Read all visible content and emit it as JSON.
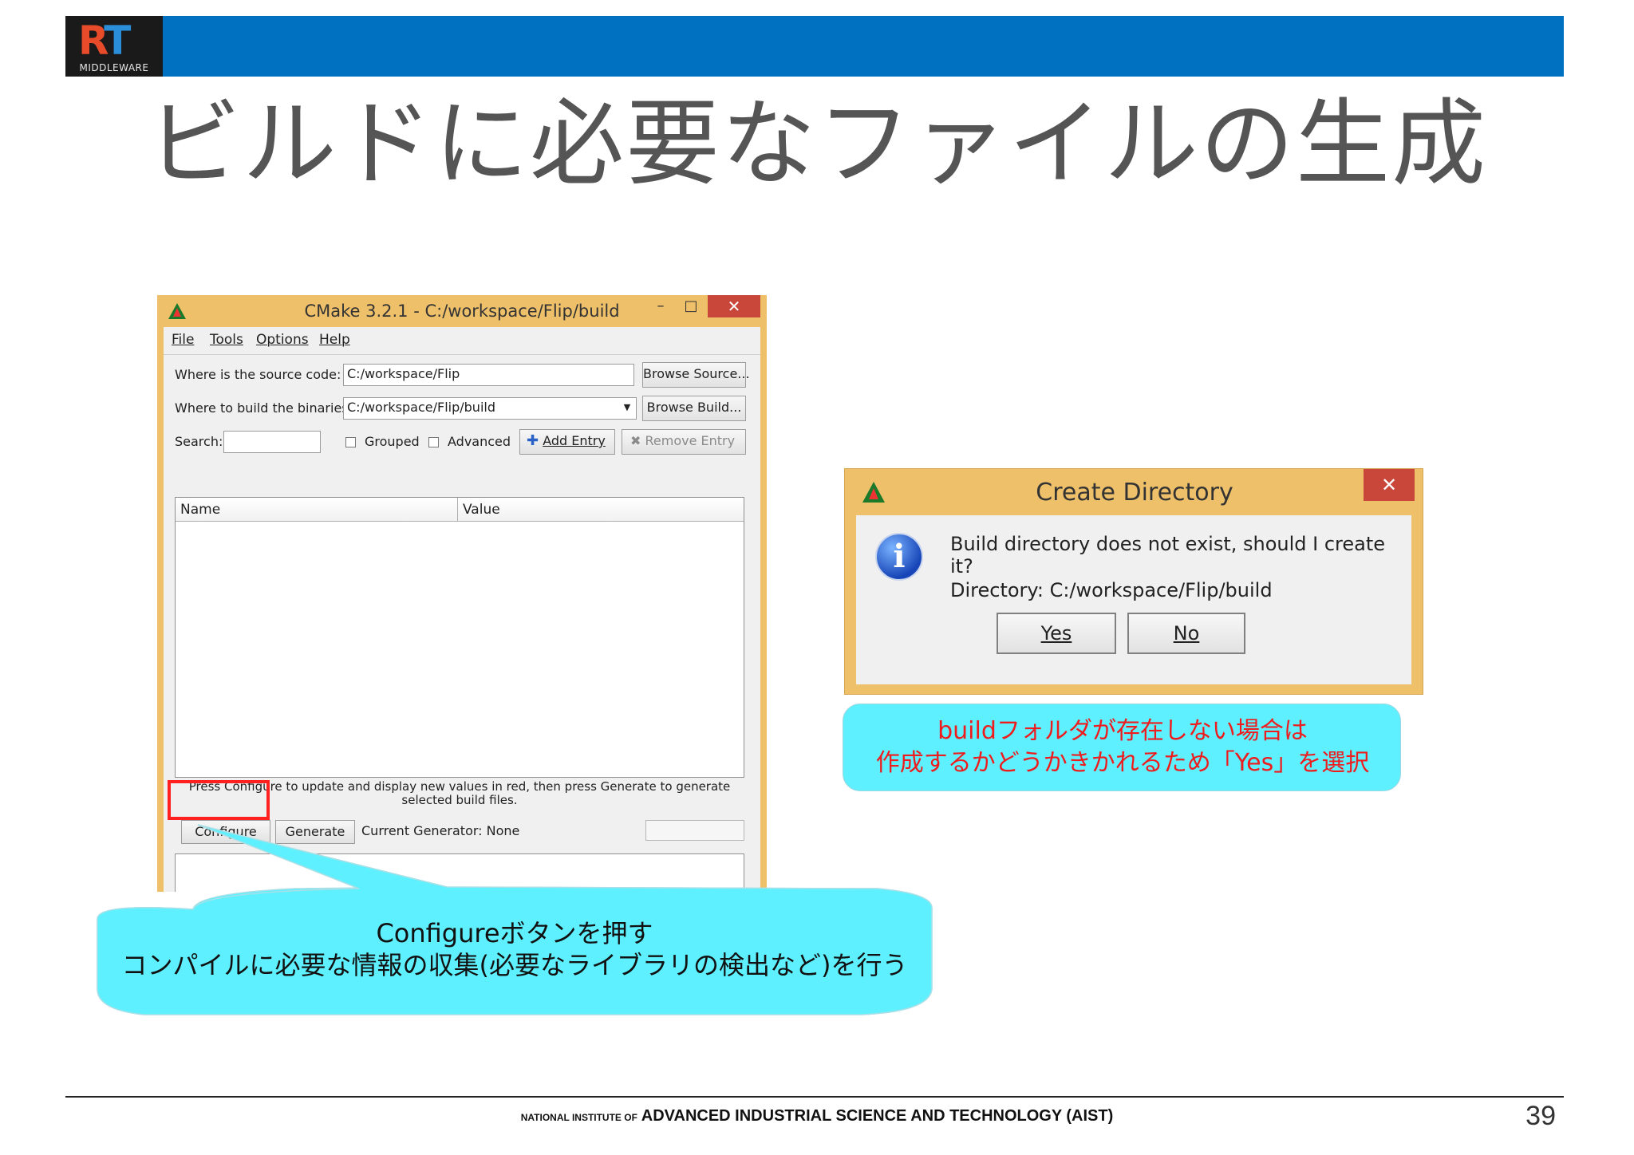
{
  "slide": {
    "title": "ビルドに必要なファイルの生成",
    "logo_text": "MIDDLEWARE",
    "logo_mark": "RT",
    "footer_prefix": "NATIONAL INSTITUTE OF",
    "footer_main": "ADVANCED INDUSTRIAL SCIENCE AND TECHNOLOGY (AIST)",
    "page_number": "39",
    "header_color": "#0070c0"
  },
  "cmake": {
    "title": "CMake 3.2.1 - C:/workspace/Flip/build",
    "minimize": "–",
    "maximize": "□",
    "close": "✕",
    "menu": [
      "File",
      "Tools",
      "Options",
      "Help"
    ],
    "source_label": "Where is the source code:",
    "source_value": "C:/workspace/Flip",
    "browse_source": "Browse Source...",
    "build_label": "Where to build the binaries:",
    "build_value": "C:/workspace/Flip/build",
    "browse_build": "Browse Build...",
    "search_label": "Search:",
    "search_value": "",
    "grouped_label": "Grouped",
    "advanced_label": "Advanced",
    "add_entry": "Add Entry",
    "remove_entry": "Remove Entry",
    "columns": [
      "Name",
      "Value"
    ],
    "hint": "Press Configure to update and display new values in red, then press Generate to generate selected build files.",
    "configure": "Configure",
    "generate": "Generate",
    "current_generator": "Current Generator: None"
  },
  "dialog": {
    "title": "Create Directory",
    "close": "✕",
    "message": "Build directory does not exist, should I create it?",
    "directory": "Directory: C:/workspace/Flip/build",
    "yes": "Yes",
    "no": "No",
    "icon": "info-icon"
  },
  "callouts": {
    "right_line1": "buildフォルダが存在しない場合は",
    "right_line2": "作成するかどうかきかれるため「Yes」を選択",
    "left_line1": "Configureボタンを押す",
    "left_line2": "コンパイルに必要な情報の収集(必要なライブラリの検出など)を行う",
    "bubble_color": "#5ff0ff",
    "highlight_color": "#ff2020"
  }
}
